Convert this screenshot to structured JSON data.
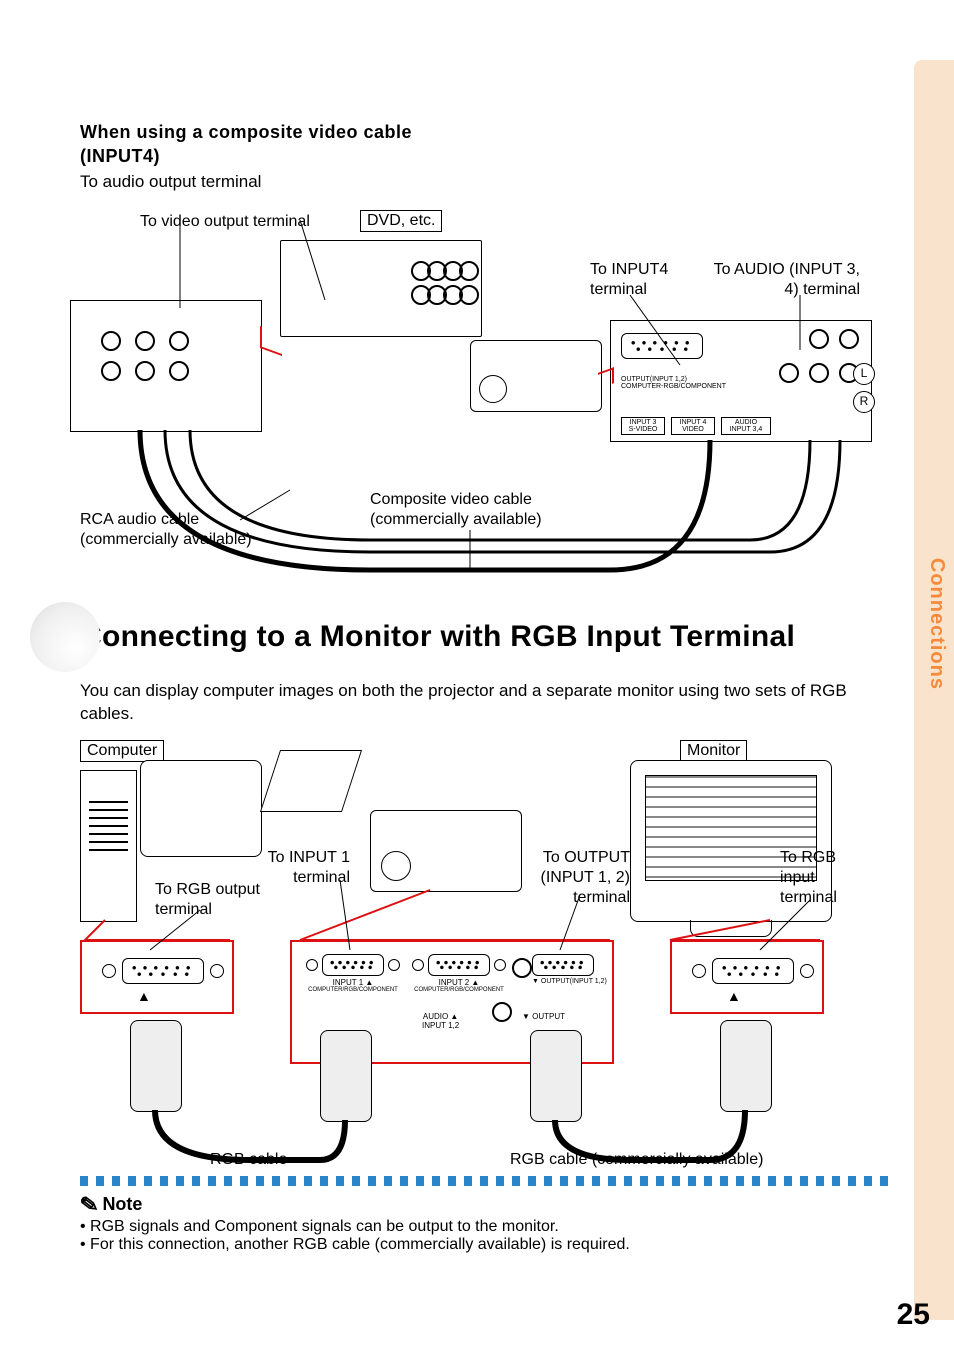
{
  "side_tab_label": "Connections",
  "page_number": "25",
  "section1": {
    "title_line1": "When using a composite video cable",
    "title_line2": "(INPUT4)",
    "to_audio_output": "To audio output terminal",
    "to_video_output": "To video output terminal",
    "dvd_label": "DVD, etc.",
    "to_input4": "To INPUT4 terminal",
    "to_audio_input34": "To AUDIO (INPUT 3, 4) terminal",
    "lr_L": "L",
    "lr_R": "R",
    "rca_cable": "RCA audio cable (commercially available)",
    "composite_cable": "Composite video cable (commercially available)"
  },
  "section2": {
    "heading": "Connecting to a Monitor with RGB Input Terminal",
    "intro": "You can display computer images on both the projector and a separate monitor using two sets of RGB cables.",
    "computer_label": "Computer",
    "monitor_label": "Monitor",
    "to_rgb_output": "To RGB output terminal",
    "to_input1": "To INPUT 1 terminal",
    "to_output_input12": "To OUTPUT (INPUT 1, 2) terminal",
    "to_rgb_input": "To RGB input terminal",
    "rgb_cable_left": "RGB cable",
    "rgb_cable_right": "RGB cable (commercially available)",
    "panel_input1": "INPUT 1",
    "panel_input1_sub": "COMPUTER/RGB/COMPONENT",
    "panel_input2": "INPUT 2",
    "panel_input2_sub": "COMPUTER/RGB/COMPONENT",
    "panel_output": "OUTPUT(INPUT 1,2)",
    "panel_audio": "AUDIO",
    "panel_audio_sub": "INPUT 1,2",
    "panel_audio_out": "OUTPUT"
  },
  "note": {
    "label": "Note",
    "bullet1": "RGB signals and Component signals can be output to the monitor.",
    "bullet2": "For this connection, another RGB cable (commercially available) is required."
  }
}
